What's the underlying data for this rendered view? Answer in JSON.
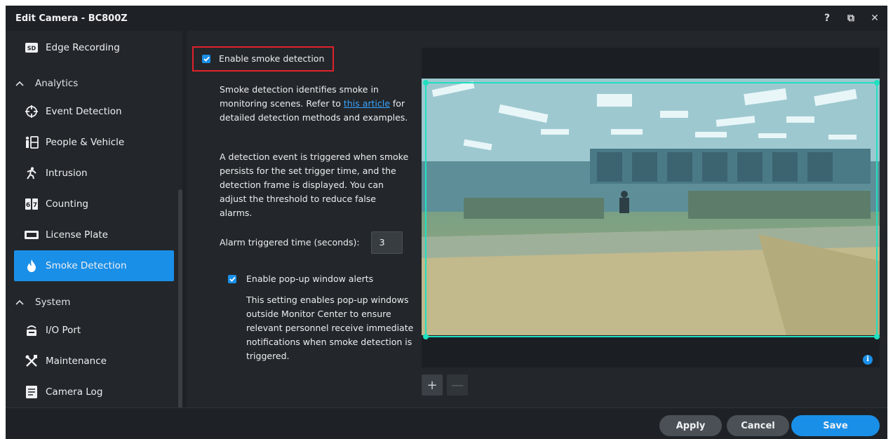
{
  "window": {
    "title": "Edit Camera - BC800Z",
    "controls": {
      "help": "?",
      "restore": "⧉",
      "close": "✕"
    }
  },
  "sidebar": {
    "items": [
      {
        "label": "Edge Recording",
        "icon": "sd-card-icon"
      },
      {
        "label": "Event Detection",
        "icon": "crosshair-icon"
      },
      {
        "label": "People & Vehicle",
        "icon": "people-vehicle-icon"
      },
      {
        "label": "Intrusion",
        "icon": "running-person-icon"
      },
      {
        "label": "Counting",
        "icon": "counter-icon"
      },
      {
        "label": "License Plate",
        "icon": "license-plate-icon"
      },
      {
        "label": "Smoke Detection",
        "icon": "flame-icon",
        "active": true
      },
      {
        "label": "I/O Port",
        "icon": "io-port-icon"
      },
      {
        "label": "Maintenance",
        "icon": "tools-icon"
      },
      {
        "label": "Camera Log",
        "icon": "log-icon"
      }
    ],
    "groups": {
      "analytics": "Analytics",
      "system": "System"
    }
  },
  "settings": {
    "enable_label": "Enable smoke detection",
    "enable_checked": true,
    "desc1_a": "Smoke detection identifies smoke in monitoring scenes. Refer to ",
    "desc1_link": "this article",
    "desc1_b": " for detailed detection methods and examples.",
    "desc2": "A detection event is triggered when smoke persists for the set trigger time, and the detection frame is displayed. You can adjust the threshold to reduce false alarms.",
    "alarm_label": "Alarm triggered time (seconds):",
    "alarm_value": "3",
    "popup_label": "Enable pop-up window alerts",
    "popup_checked": true,
    "popup_desc": "This setting enables pop-up windows outside Monitor Center to ensure relevant personnel receive immediate notifications when smoke detection is triggered."
  },
  "viewer": {
    "info_glyph": "i",
    "zoom_in": "+",
    "zoom_out": "—"
  },
  "footer": {
    "apply": "Apply",
    "cancel": "Cancel",
    "save": "Save"
  },
  "colors": {
    "accent": "#1a8fe8",
    "zone": "#1fe0c0",
    "highlight": "#e0212b"
  }
}
